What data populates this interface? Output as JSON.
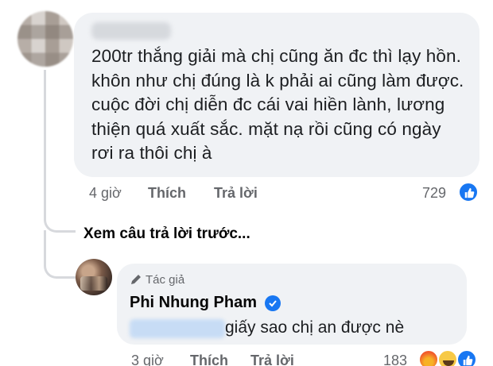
{
  "comment": {
    "author_name": "Nhung Pham",
    "body": "200tr thắng giải mà chị cũng ăn đc thì lạy hồn. khôn như chị đúng là k phải ai cũng làm được. cuộc đời chị diễn đc cái vai hiền lành, lương thiện quá xuất sắc. mặt nạ rồi cũng có ngày rơi ra thôi chị à",
    "time": "4 giờ",
    "like_label": "Thích",
    "reply_label": "Trả lời",
    "reaction_count": "729",
    "reaction_icon": "like-icon"
  },
  "view_previous_label": "Xem câu trả lời trước...",
  "reply": {
    "badge": "Tác giả",
    "badge_icon": "pencil-icon",
    "author_name": "Phi Nhung Pham",
    "verified": true,
    "mention": "Nhung Pham",
    "text": "giấy sao chị an được nè",
    "time": "3 giờ",
    "like_label": "Thích",
    "reply_label": "Trả lời",
    "reaction_count": "183",
    "reaction_icons": [
      "angry-icon",
      "laugh-icon",
      "like-icon"
    ]
  },
  "colors": {
    "bubble": "#f0f2f5",
    "meta_text": "#65676b",
    "accent": "#1877f2",
    "thread_line": "#d7d9dd"
  }
}
